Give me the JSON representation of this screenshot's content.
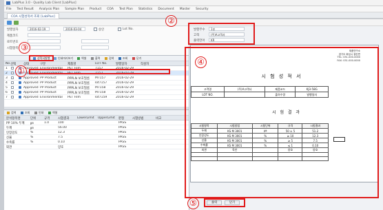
{
  "window": {
    "title": "LabPlus 3.0 - Quality Lab Client [LabPlus]"
  },
  "menu": [
    "File",
    "Test Result",
    "Analysis Plan",
    "Sample Plan",
    "Product",
    "COA",
    "Test Plan",
    "Statistics",
    "Document",
    "Master",
    "Security"
  ],
  "tab": {
    "label": "COA 시험성적서 조회 [LabPlus]"
  },
  "filters": {
    "date_label": "발행일자",
    "date_from": "2016-02-19",
    "date_to": "2016-03-04",
    "product_label": "제품코드",
    "lot_label": "로트번호",
    "test_label": "시험항목",
    "status_check": "승인",
    "lot_check": "Lot No."
  },
  "grid_top": {
    "toolbar": [
      "성적서발행",
      "인쇄미리보기",
      "엑셀",
      "출력",
      "검색",
      "조회",
      "닫기"
    ],
    "columns": [
      "No",
      "선택",
      "상태",
      "구분",
      "제품명",
      "LOT No.",
      "발행일자",
      "작성자"
    ],
    "rows": [
      [
        "1",
        "",
        "Approved",
        "Environmental",
        "PET Film",
        "7157",
        "2016-02-29",
        ""
      ],
      [
        "2",
        "",
        "Approved",
        "Environmental",
        "PET Film",
        "7157",
        "2016-02-29",
        ""
      ],
      [
        "3",
        "",
        "Approved",
        "PP Product",
        "PPPLN 보호필름",
        "M7157",
        "2016-02-29",
        ""
      ],
      [
        "4",
        "",
        "Approved",
        "PP Product",
        "PPPLN 보호필름",
        "lot7157",
        "2016-02-29",
        ""
      ],
      [
        "5",
        "",
        "Approved",
        "PP Product",
        "PPPLN 보호필름",
        "M7158",
        "2016-02-29",
        ""
      ],
      [
        "6",
        "",
        "Approved",
        "PP Product",
        "PPPLN 보호필름",
        "M7158",
        "2016-02-29",
        ""
      ],
      [
        "7",
        "",
        "Approved",
        "Environmental",
        "PET Film",
        "lot7159",
        "2016-02-29",
        ""
      ]
    ]
  },
  "grid_bottom": {
    "toolbar": [
      "검색",
      "조회",
      "인쇄",
      "엑셀"
    ],
    "columns": [
      "분석항목명",
      "단위",
      "규격",
      "시험결과",
      "LowerLimit",
      "UpperLimit",
      "판정",
      "시험방법",
      "비고"
    ],
    "rows": [
      [
        "PP 10% 두께",
        "㎛",
        "1.0",
        "100",
        "",
        "",
        "PASS",
        "",
        ""
      ],
      [
        "두께",
        "㎛",
        "",
        "56.00",
        "",
        "",
        "PASS",
        "",
        ""
      ],
      [
        "인장강도",
        "%",
        "",
        "12.3",
        "",
        "",
        "PASS",
        "",
        ""
      ],
      [
        "신율",
        "%",
        "",
        "7.5",
        "",
        "",
        "PASS",
        "",
        ""
      ],
      [
        "수축률",
        "%",
        "",
        "0.10",
        "",
        "",
        "PASS",
        "",
        ""
      ],
      [
        "외관",
        "",
        "",
        "양호",
        "",
        "",
        "PASS",
        "",
        ""
      ]
    ]
  },
  "right": {
    "print_label": "발행부수",
    "print_value": "1부",
    "dest_label": "고객",
    "dest_value": "(주)A고객사",
    "lang_label": "출력언어",
    "lang_value": "KR"
  },
  "doc": {
    "header": [
      "제품연구소",
      "경기도 화성시 동탄면",
      "TEL: 031-000-0000",
      "FAX: 031-000-0000"
    ],
    "title": "시 험 성 적 서",
    "info_rows": [
      [
        "고객명",
        "(주)A고객사",
        "제품코드",
        "KJ3-58G"
      ],
      [
        "LOT NO.",
        "",
        "출하수량",
        "발행일자"
      ]
    ],
    "section_title": "시 험 결 과",
    "result_columns": [
      "시험항목",
      "시험방법",
      "시험단위",
      "규격",
      "시험결과"
    ],
    "result_rows": [
      [
        "두께",
        "KS M 3001",
        "㎛",
        "50 ± 5",
        "51.2"
      ],
      [
        "인장강도",
        "KS M 3001",
        "%",
        "≥ 10",
        "12.3"
      ],
      [
        "신율",
        "KS M 3001",
        "%",
        "≥ 5",
        "7.5"
      ],
      [
        "수축률",
        "KS M 3001",
        "%",
        "≤ 1",
        "0.10"
      ],
      [
        "외관",
        "육안",
        "",
        "양호",
        "양호"
      ],
      [
        "",
        "",
        "",
        "",
        ""
      ],
      [
        "",
        "",
        "",
        "",
        ""
      ]
    ]
  },
  "bottom_buttons": {
    "print": "출력",
    "close": "닫기"
  },
  "annotations": [
    "①",
    "②",
    "③",
    "④",
    "⑤"
  ]
}
